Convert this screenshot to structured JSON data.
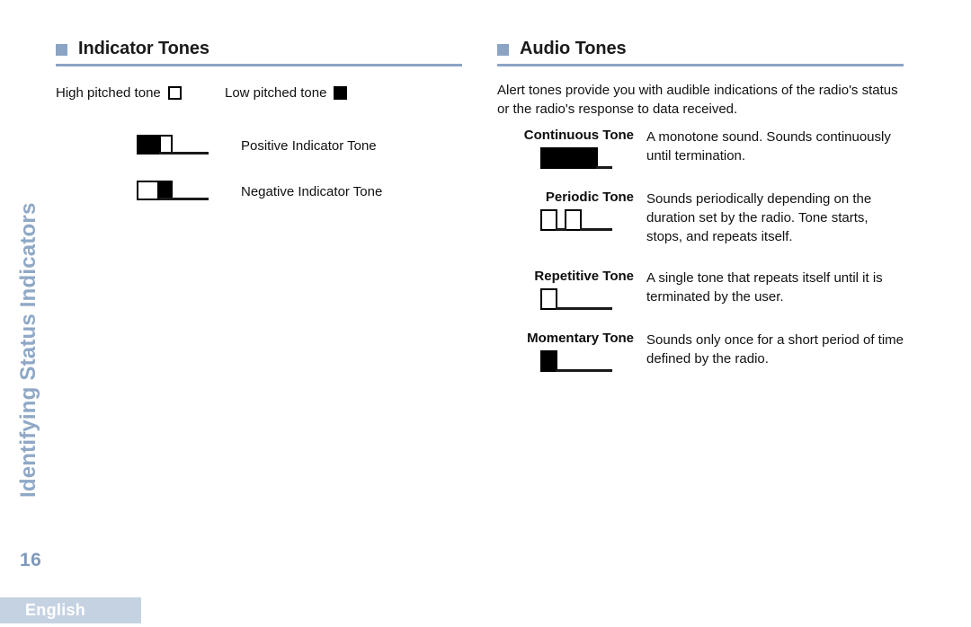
{
  "document": {
    "chapter_title": "Identifying Status Indicators",
    "page_number": "16",
    "language": "English"
  },
  "theme": {
    "accent": "#8ba4c4",
    "accent_text": "#8fa8c6",
    "language_bar_bg": "#c5d2e2",
    "body_text": "#111111",
    "glyph_black": "#000000"
  },
  "sections": {
    "indicator_tones": {
      "heading": "Indicator Tones",
      "legend": [
        {
          "label": "High pitched tone",
          "swatch": "hollow-square"
        },
        {
          "label": "Low pitched tone",
          "swatch": "solid-square"
        }
      ],
      "rows": [
        {
          "description": "Positive Indicator Tone",
          "glyph": "low-then-high-pulse"
        },
        {
          "description": "Negative Indicator Tone",
          "glyph": "high-then-low-pulse"
        }
      ]
    },
    "audio_tones": {
      "heading": "Audio Tones",
      "intro": "Alert tones provide you with audible indications of the radio's status or the radio's response to data received.",
      "items": [
        {
          "name": "Continuous Tone",
          "description": "A monotone sound. Sounds continuously until termination.",
          "glyph": "continuous-waveform"
        },
        {
          "name": "Periodic Tone",
          "description": "Sounds periodically depending on the duration set by the radio. Tone starts, stops, and repeats itself.",
          "glyph": "periodic-waveform"
        },
        {
          "name": "Repetitive Tone",
          "description": "A single tone that repeats itself until it is terminated by the user.",
          "glyph": "repetitive-waveform"
        },
        {
          "name": "Momentary Tone",
          "description": "Sounds only once for a short period of time defined by the radio.",
          "glyph": "momentary-waveform"
        }
      ]
    }
  }
}
